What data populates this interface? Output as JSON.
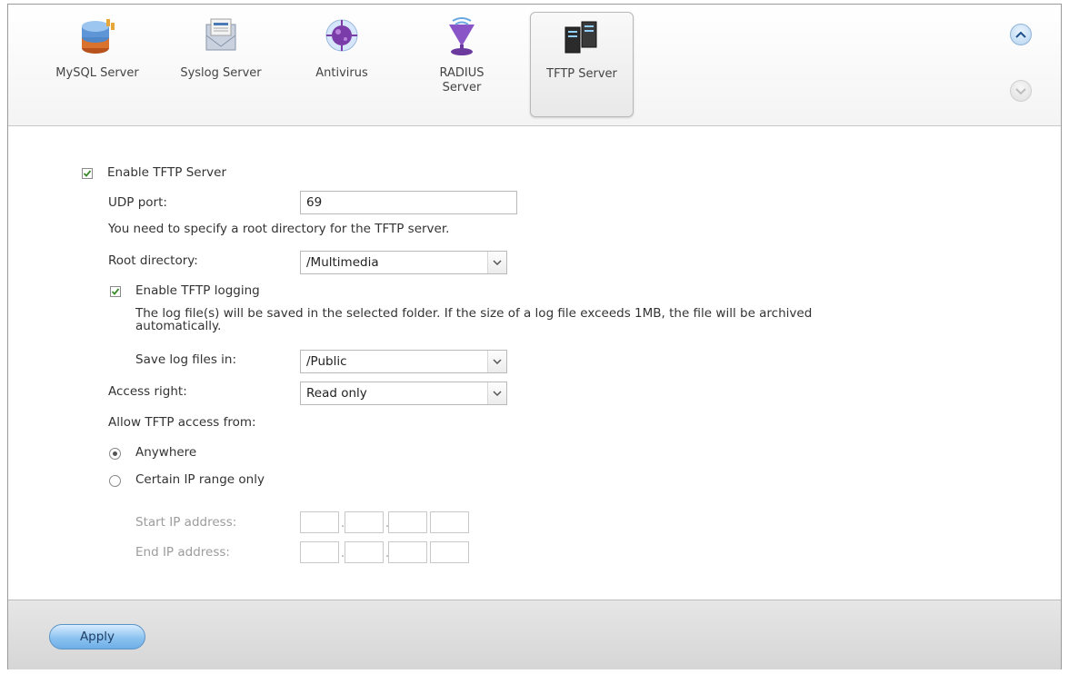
{
  "tabs": [
    {
      "label": "MySQL Server",
      "icon": "database-icon"
    },
    {
      "label": "Syslog Server",
      "icon": "envelope-icon"
    },
    {
      "label": "Antivirus",
      "icon": "antivirus-icon"
    },
    {
      "label": "RADIUS",
      "label2": "Server",
      "icon": "radius-icon"
    },
    {
      "label": "TFTP Server",
      "icon": "tftp-server-icon",
      "active": true
    }
  ],
  "form": {
    "enable_tftp_label": "Enable TFTP Server",
    "enable_tftp_checked": true,
    "udp_port_label": "UDP port:",
    "udp_port_value": "69",
    "root_dir_note": "You need to specify a root directory for the TFTP server.",
    "root_dir_label": "Root directory:",
    "root_dir_value": "/Multimedia",
    "enable_logging_label": "Enable TFTP logging",
    "enable_logging_checked": true,
    "log_note_line1": "The log file(s) will be saved in the selected folder. If the size of a log file exceeds 1MB, the file will be archived",
    "log_note_line2": "automatically.",
    "save_log_label": "Save log files in:",
    "save_log_value": "/Public",
    "access_right_label": "Access right:",
    "access_right_value": "Read only",
    "allow_from_label": "Allow TFTP access from:",
    "anywhere_label": "Anywhere",
    "ip_range_label": "Certain IP range only",
    "selected_access": "Anywhere",
    "start_ip_label": "Start IP address:",
    "end_ip_label": "End IP address:"
  },
  "footer": {
    "apply_label": "Apply"
  },
  "colors": {
    "accent": "#8cc3f0",
    "check": "#3a8a2a"
  }
}
